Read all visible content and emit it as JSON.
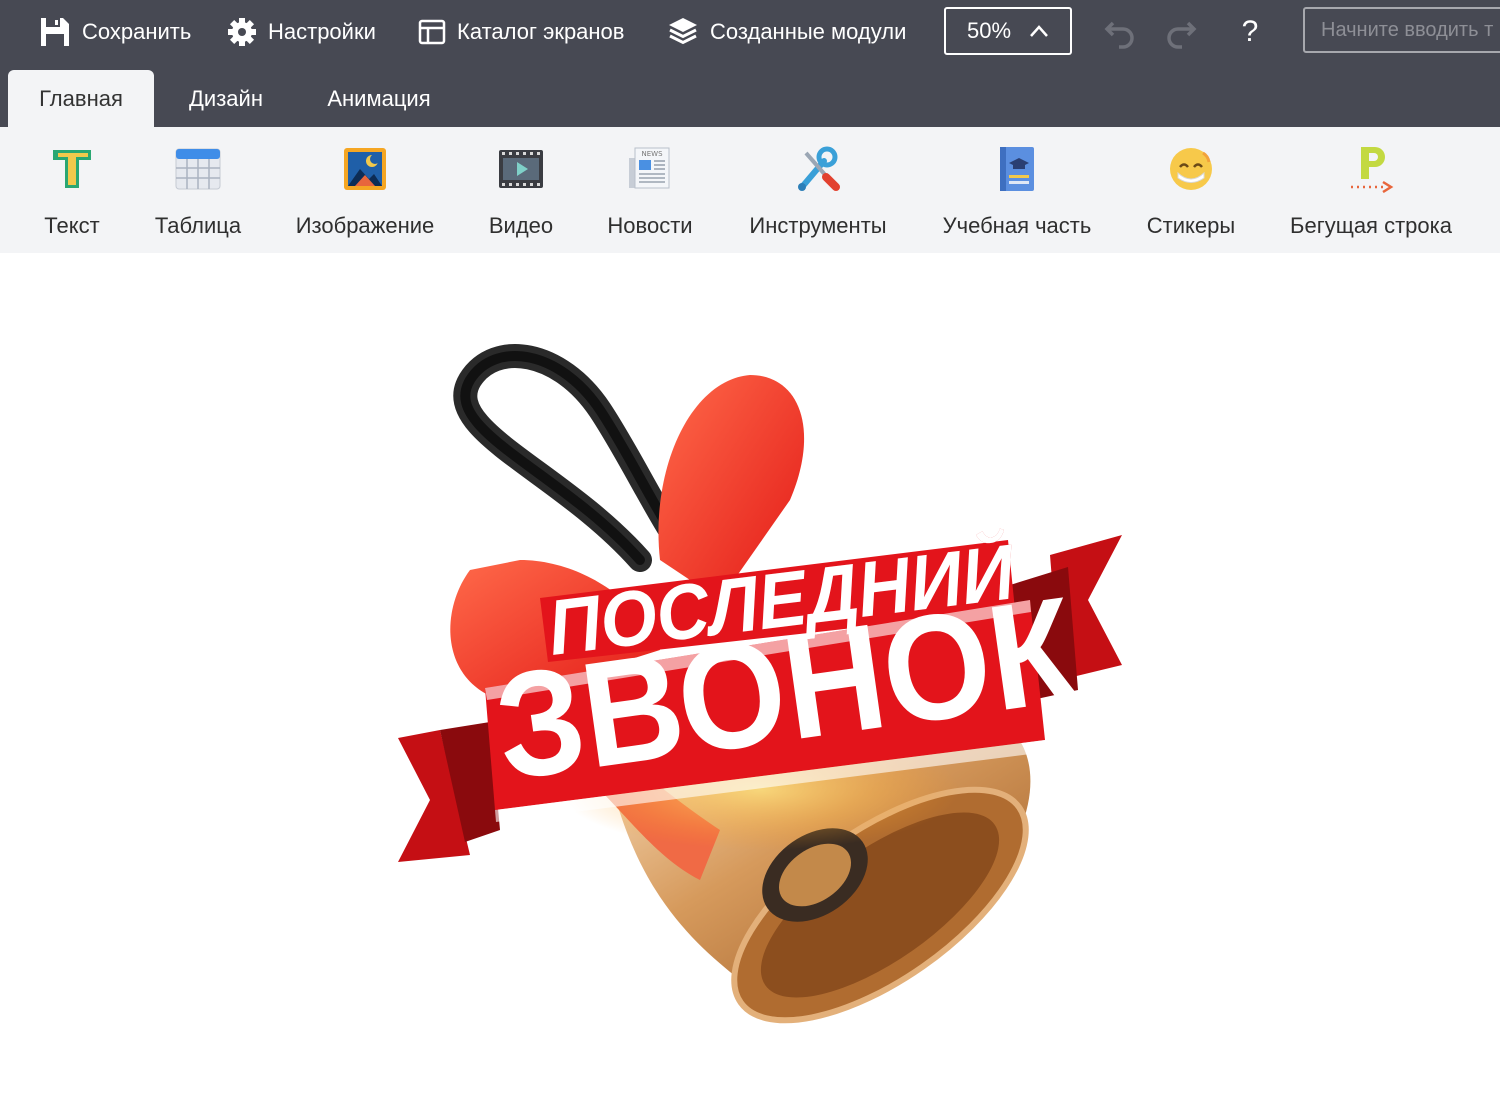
{
  "toolbar": {
    "save_label": "Сохранить",
    "settings_label": "Настройки",
    "catalog_label": "Каталог экранов",
    "modules_label": "Созданные модули",
    "zoom": "50%",
    "help_label": "?",
    "search_placeholder": "Начните вводить т"
  },
  "tabs": [
    {
      "label": "Главная",
      "active": true
    },
    {
      "label": "Дизайн",
      "active": false
    },
    {
      "label": "Анимация",
      "active": false
    }
  ],
  "ribbon": {
    "items": [
      {
        "label": "Текст",
        "icon": "text-icon"
      },
      {
        "label": "Таблица",
        "icon": "table-icon"
      },
      {
        "label": "Изображение",
        "icon": "image-icon"
      },
      {
        "label": "Видео",
        "icon": "video-icon"
      },
      {
        "label": "Новости",
        "icon": "news-icon"
      },
      {
        "label": "Инструменты",
        "icon": "tools-icon"
      },
      {
        "label": "Учебная часть",
        "icon": "book-icon"
      },
      {
        "label": "Стикеры",
        "icon": "sticker-icon"
      },
      {
        "label": "Бегущая строка",
        "icon": "ticker-icon"
      }
    ]
  },
  "canvas": {
    "banner_line1": "ПОСЛЕДНИЙ",
    "banner_line2": "ЗВОНОК"
  },
  "colors": {
    "topbar": "#474953",
    "ribbon": "#f3f4f6",
    "banner_red": "#e3141b",
    "bell_gold": "#c9894f"
  }
}
